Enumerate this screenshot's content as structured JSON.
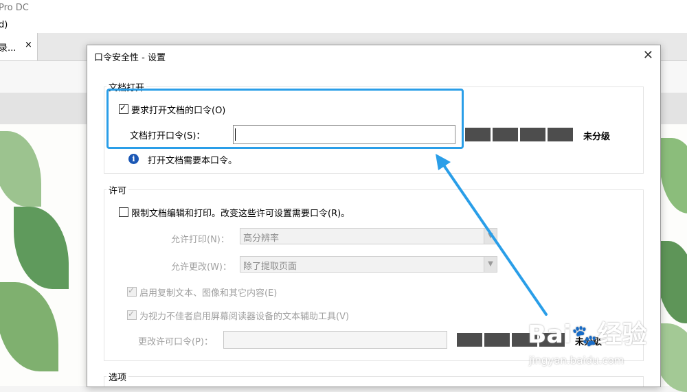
{
  "app": {
    "title": "Pro DC",
    "menu_fragment": "d)"
  },
  "tab": {
    "label": "录...",
    "close": "×"
  },
  "dialog": {
    "title": "口令安全性 - 设置",
    "close": "✕",
    "open_section": {
      "title": "文档打开",
      "require_label": "要求打开文档的口令(O)",
      "require_checked": true,
      "password_label": "文档打开口令(S)：",
      "password_value": "",
      "strength_label": "未分级",
      "info_text": "打开文档需要本口令。"
    },
    "permissions_section": {
      "title": "许可",
      "restrict_label": "限制文档编辑和打印。改变这些许可设置需要口令(R)。",
      "restrict_checked": false,
      "print_label": "允许打印(N)：",
      "print_value": "高分辨率",
      "change_label": "允许更改(W)：",
      "change_value": "除了提取页面",
      "copy_label": "启用复制文本、图像和其它内容(E)",
      "copy_checked": true,
      "access_label": "为视力不佳者启用屏幕阅读器设备的文本辅助工具(V)",
      "access_checked": true,
      "perm_password_label": "更改许可口令(P)：",
      "perm_password_value": "",
      "perm_strength_fragment": "未分级"
    },
    "options_section": {
      "title": "选项"
    }
  },
  "watermark": {
    "brand": "Bai",
    "brand_cn": "经验",
    "url": "jingyan.baidu.com"
  },
  "colors": {
    "accent": "#2a9ee8",
    "info": "#1a57b5",
    "strength": "#4d4d4d"
  }
}
